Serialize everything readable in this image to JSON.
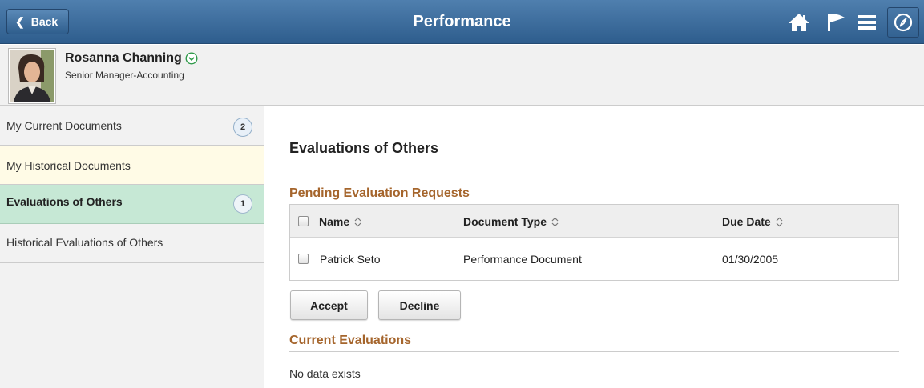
{
  "header": {
    "back_label": "Back",
    "title": "Performance",
    "icons": [
      "home-icon",
      "flag-icon",
      "hamburger-menu-icon",
      "compass-icon"
    ]
  },
  "employee": {
    "name": "Rosanna Channing",
    "title": "Senior Manager-Accounting"
  },
  "sidebar": {
    "items": [
      {
        "label": "My Current Documents",
        "count": "2"
      },
      {
        "label": "My Historical Documents"
      },
      {
        "label": "Evaluations of Others",
        "count": "1",
        "selected": true
      },
      {
        "label": "Historical Evaluations of Others"
      }
    ]
  },
  "main": {
    "title": "Evaluations of Others",
    "pending": {
      "title": "Pending Evaluation Requests",
      "columns": [
        "Name",
        "Document Type",
        "Due Date"
      ],
      "rows": [
        {
          "name": "Patrick Seto",
          "document_type": "Performance Document",
          "due_date": "01/30/2005"
        }
      ],
      "accept_label": "Accept",
      "decline_label": "Decline"
    },
    "current": {
      "title": "Current Evaluations",
      "empty_text": "No data exists"
    }
  },
  "colors": {
    "header": "#3a6a99",
    "section_title": "#a5652c",
    "selected_item": "#c6e8d5",
    "highlight_item": "#fffbe6",
    "panel": "#f2f2f2"
  }
}
